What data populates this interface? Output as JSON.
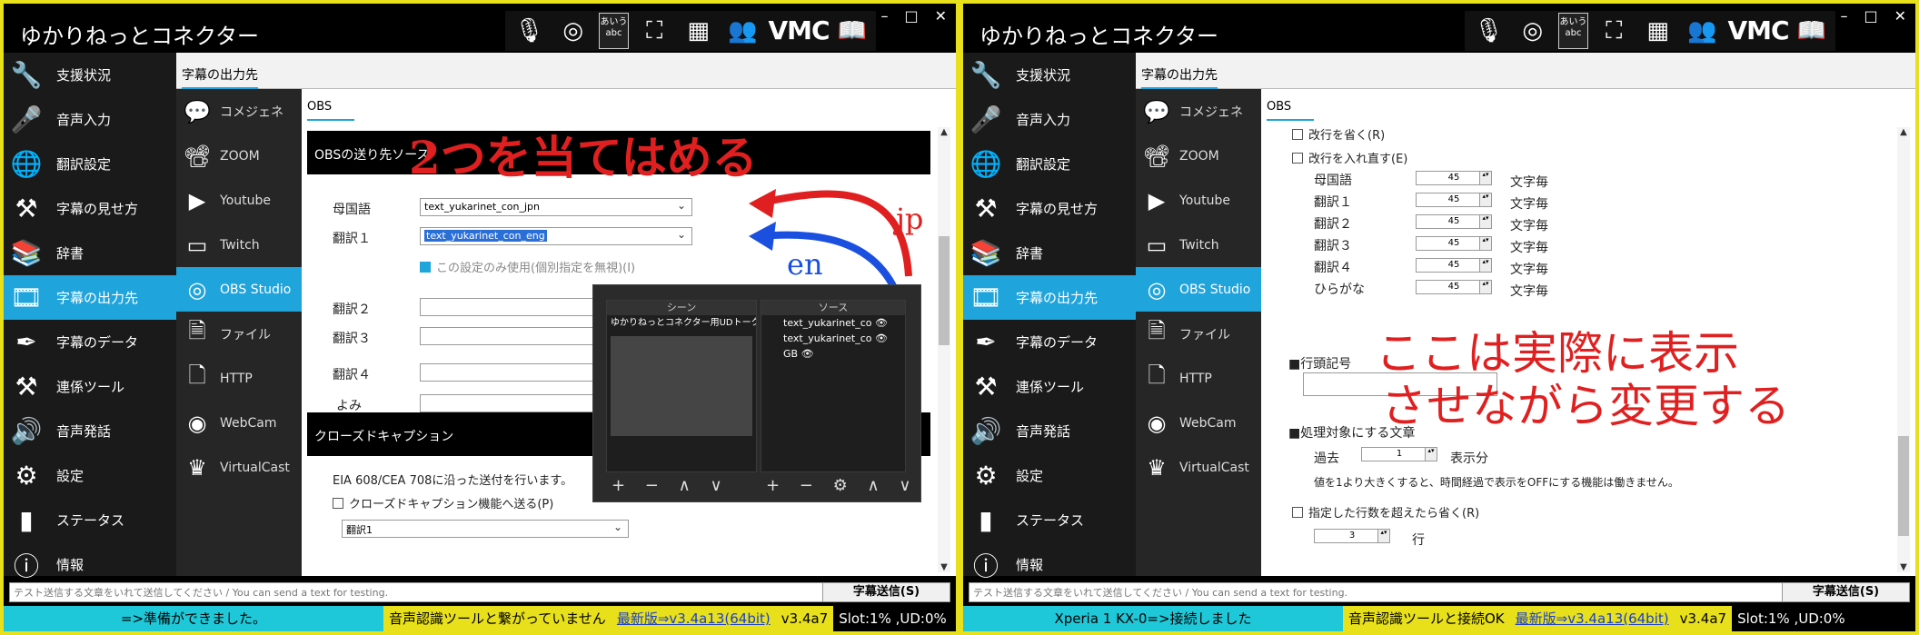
{
  "left": {
    "app_title": "ゆかりねっとコネクター",
    "toolbar": {
      "vmc": "VMC",
      "abc_label": "あいう\nabc"
    },
    "sidebar": [
      {
        "label": "支援状況",
        "icon": "wrench-icon"
      },
      {
        "label": "音声入力",
        "icon": "microphone-icon"
      },
      {
        "label": "翻訳設定",
        "icon": "globe-icon"
      },
      {
        "label": "字幕の見せ方",
        "icon": "tools-icon"
      },
      {
        "label": "辞書",
        "icon": "book-icon"
      },
      {
        "label": "字幕の出力先",
        "icon": "film-icon"
      },
      {
        "label": "字幕のデータ",
        "icon": "pen-icon"
      },
      {
        "label": "連係ツール",
        "icon": "tools-icon"
      },
      {
        "label": "音声発話",
        "icon": "speaker-icon"
      },
      {
        "label": "設定",
        "icon": "gear-icon"
      },
      {
        "label": "ステータス",
        "icon": "bar-chart-icon"
      },
      {
        "label": "情報",
        "icon": "info-icon"
      }
    ],
    "header_tab": "字幕の出力先",
    "sub_sidebar": [
      {
        "label": "コメジェネ",
        "icon": "comment-icon"
      },
      {
        "label": "ZOOM",
        "icon": "presentation-icon"
      },
      {
        "label": "Youtube",
        "icon": "play-icon"
      },
      {
        "label": "Twitch",
        "icon": "twitch-icon"
      },
      {
        "label": "OBS Studio",
        "icon": "obs-icon"
      },
      {
        "label": "ファイル",
        "icon": "file-icon"
      },
      {
        "label": "HTTP",
        "icon": "html-icon"
      },
      {
        "label": "WebCam",
        "icon": "webcam-icon"
      },
      {
        "label": "VirtualCast",
        "icon": "avatar-icon"
      }
    ],
    "content_tab": "OBS",
    "section_obs": "OBSの送り先ソース",
    "annotation_main": "2つを当てはめる",
    "fields": {
      "native_label": "母国語",
      "native_value": "text_yukarinet_con_jpn",
      "trans1_label": "翻訳１",
      "trans1_value": "text_yukarinet_con_eng",
      "only_setting": "この設定のみ使用(個別指定を無視)(I)",
      "trans2_label": "翻訳２",
      "trans3_label": "翻訳３",
      "trans4_label": "翻訳４",
      "yomi_label": "よみ"
    },
    "anno_jp": "jp",
    "anno_en": "en",
    "obs": {
      "scenes_header": "シーン",
      "sources_header": "ソース",
      "scene_item": "ゆかりねっとコネクター用UDトーク字幕",
      "sources": [
        "text_yukarinet_co",
        "text_yukarinet_co",
        "GB"
      ],
      "tools_scenes": "+ − ∧ ∨",
      "tools_sources": "+ − ⚙ ∧ ∨"
    },
    "section_cc": "クローズドキャプション",
    "cc_desc": "EIA 608/CEA 708に沿った送付を行います。",
    "cc_check": "クローズドキャプション機能へ送る(P)",
    "cc_select": "翻訳1",
    "input_placeholder": "テスト送信する文章をいれて送信してください / You can send a text for testing.",
    "send_button": "字幕送信(S)",
    "status": {
      "message": "=>準備ができました。",
      "tool": "音声認識ツールと繋がっていません",
      "update": "最新版⇒v3.4a13(64bit)",
      "version": "v3.4a7",
      "slot": "Slot:1% ,UD:0%"
    }
  },
  "right": {
    "app_title": "ゆかりねっとコネクター",
    "header_tab": "字幕の出力先",
    "content_tab": "OBS",
    "opt_remove_newline": "改行を省く(R)",
    "opt_reinsert_newline": "改行を入れ直す(E)",
    "rows": [
      {
        "label": "母国語",
        "value": "45",
        "unit": "文字毎"
      },
      {
        "label": "翻訳１",
        "value": "45",
        "unit": "文字毎"
      },
      {
        "label": "翻訳２",
        "value": "45",
        "unit": "文字毎"
      },
      {
        "label": "翻訳３",
        "value": "45",
        "unit": "文字毎"
      },
      {
        "label": "翻訳４",
        "value": "45",
        "unit": "文字毎"
      },
      {
        "label": "ひらがな",
        "value": "45",
        "unit": "文字毎"
      }
    ],
    "line_head_title": "■行頭記号",
    "annotation_1": "ここは実際に表示",
    "annotation_2": "させながら変更する",
    "process_title": "■処理対象にする文章",
    "past_label": "過去",
    "past_value": "1",
    "past_unit": "表示分",
    "past_note": "値を1より大きくすると、時間経過で表示をOFFにする機能は働きません。",
    "opt_omit_lines": "指定した行数を超えたら省く(R)",
    "lines_value": "3",
    "lines_unit": "行",
    "input_placeholder": "テスト送信する文章をいれて送信してください / You can send a text for testing.",
    "send_button": "字幕送信(S)",
    "status": {
      "message": "Xperia 1 KX-0=>接続しました",
      "tool": "音声認識ツールと接続OK",
      "update": "最新版⇒v3.4a13(64bit)",
      "version": "v3.4a7",
      "slot": "Slot:1% ,UD:0%"
    }
  }
}
